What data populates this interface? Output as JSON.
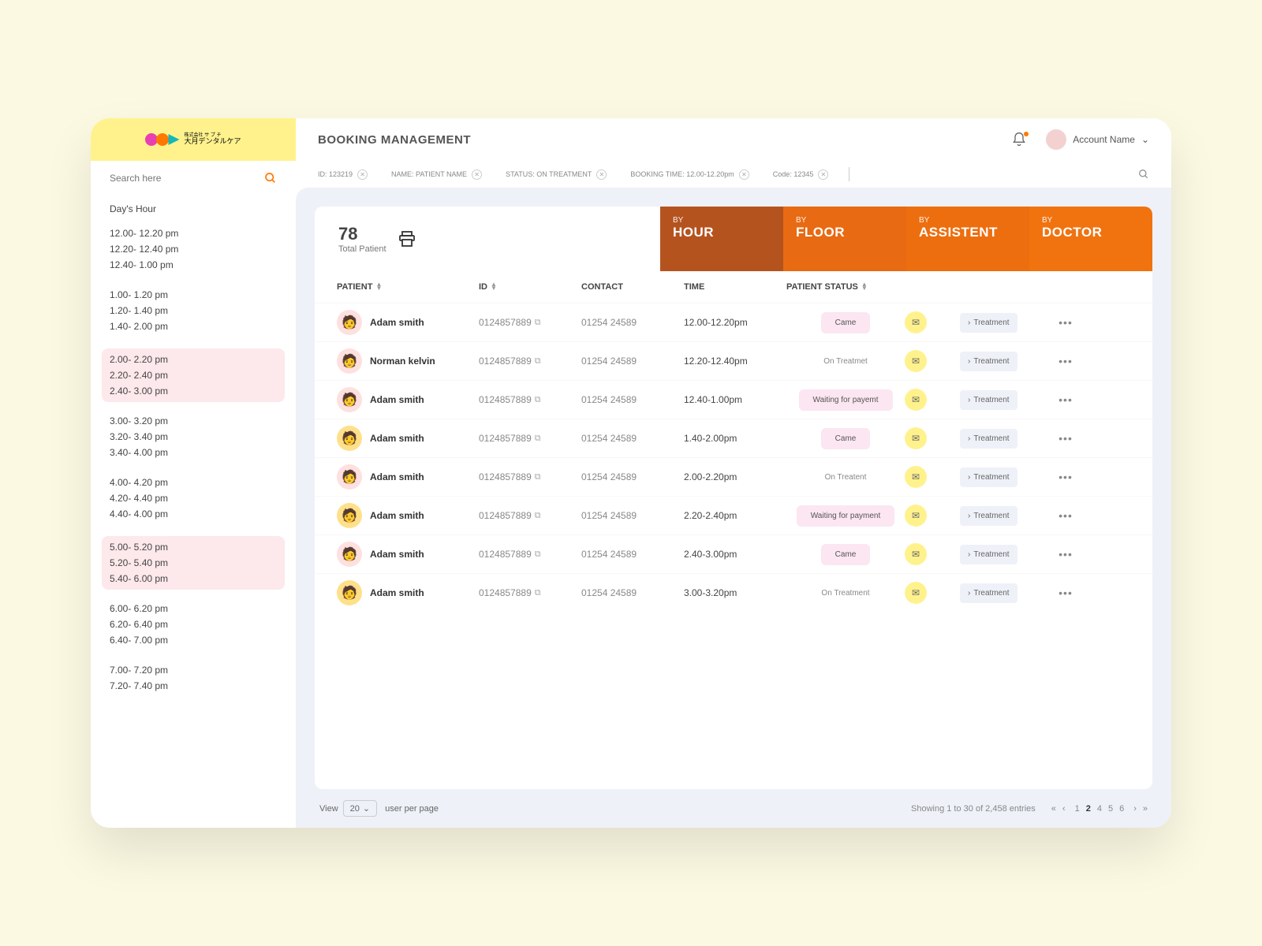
{
  "logo": {
    "top": "株式会社 サ プ チ",
    "main": "大月デンタルケア"
  },
  "search": {
    "placeholder": "Search here"
  },
  "header": {
    "title": "BOOKING MANAGEMENT",
    "account": "Account Name"
  },
  "filters": {
    "items": [
      {
        "label": "ID:",
        "value": "123219"
      },
      {
        "label": "NAME:",
        "value": "PATIENT NAME"
      },
      {
        "label": "STATUS:",
        "value": "ON TREATMENT"
      },
      {
        "label": "BOOKING TIME:",
        "value": "12.00-12.20pm"
      },
      {
        "label": "Code:",
        "value": "12345"
      }
    ]
  },
  "sidebar": {
    "title": "Day's Hour",
    "groups": [
      {
        "lines": [
          "12.00- 12.20 pm",
          "12.20- 12.40 pm",
          "12.40- 1.00 pm"
        ]
      },
      {
        "lines": [
          "1.00- 1.20 pm",
          "1.20- 1.40 pm",
          "1.40- 2.00 pm"
        ]
      },
      {
        "lines": [
          "2.00- 2.20 pm",
          "2.20- 2.40 pm",
          "2.40- 3.00 pm"
        ],
        "hl": true
      },
      {
        "lines": [
          "3.00- 3.20 pm",
          "3.20- 3.40 pm",
          "3.40- 4.00 pm"
        ]
      },
      {
        "lines": [
          "4.00- 4.20 pm",
          "4.20- 4.40 pm",
          "4.40- 4.00 pm"
        ]
      },
      {
        "lines": [
          "5.00- 5.20 pm",
          "5.20- 5.40 pm",
          "5.40- 6.00 pm"
        ],
        "hl": true
      },
      {
        "lines": [
          "6.00- 6.20 pm",
          "6.20- 6.40 pm",
          "6.40- 7.00 pm"
        ]
      },
      {
        "lines": [
          "7.00- 7.20 pm",
          "7.20- 7.40 pm"
        ]
      }
    ]
  },
  "stats": {
    "count": "78",
    "label": "Total Patient"
  },
  "tabs": [
    {
      "by": "BY",
      "main": "HOUR"
    },
    {
      "by": "BY",
      "main": "FLOOR"
    },
    {
      "by": "BY",
      "main": "ASSISTENT"
    },
    {
      "by": "BY",
      "main": "DOCTOR"
    }
  ],
  "columns": {
    "patient": "PATIENT",
    "id": "ID",
    "contact": "CONTACT",
    "time": "TIME",
    "status": "PATIENT STATUS"
  },
  "rows": [
    {
      "name": "Adam smith",
      "id": "0124857889",
      "contact": "01254 24589",
      "time": "12.00-12.20pm",
      "status": "Came",
      "pill": true,
      "btn": "Treatment",
      "avbg": "#fde0df"
    },
    {
      "name": "Norman kelvin",
      "id": "0124857889",
      "contact": "01254 24589",
      "time": "12.20-12.40pm",
      "status": "On Treatmet",
      "pill": false,
      "btn": "Treatment",
      "avbg": "#fde0df"
    },
    {
      "name": "Adam smith",
      "id": "0124857889",
      "contact": "01254 24589",
      "time": "12.40-1.00pm",
      "status": "Waiting for payemt",
      "pill": true,
      "btn": "Treatment",
      "avbg": "#fde0df"
    },
    {
      "name": "Adam smith",
      "id": "0124857889",
      "contact": "01254 24589",
      "time": "1.40-2.00pm",
      "status": "Came",
      "pill": true,
      "btn": "Treatment",
      "avbg": "#ffe08a"
    },
    {
      "name": "Adam smith",
      "id": "0124857889",
      "contact": "01254 24589",
      "time": "2.00-2.20pm",
      "status": "On Treatent",
      "pill": false,
      "btn": "Treatment",
      "avbg": "#fde0df"
    },
    {
      "name": "Adam smith",
      "id": "0124857889",
      "contact": "01254 24589",
      "time": "2.20-2.40pm",
      "status": "Waiting for payment",
      "pill": true,
      "btn": "Treatment",
      "avbg": "#ffe08a"
    },
    {
      "name": "Adam smith",
      "id": "0124857889",
      "contact": "01254 24589",
      "time": "2.40-3.00pm",
      "status": "Came",
      "pill": true,
      "btn": "Treatment",
      "avbg": "#fde0df"
    },
    {
      "name": "Adam smith",
      "id": "0124857889",
      "contact": "01254 24589",
      "time": "3.00-3.20pm",
      "status": "On Treatment",
      "pill": false,
      "btn": "Treatment",
      "avbg": "#ffe08a"
    }
  ],
  "footer": {
    "view": "View",
    "per": "20",
    "perText": "user per page",
    "showing": "Showing 1 to 30 of 2,458 entries",
    "pages": [
      "1",
      "2",
      "4",
      "5",
      "6"
    ],
    "active": "2"
  }
}
